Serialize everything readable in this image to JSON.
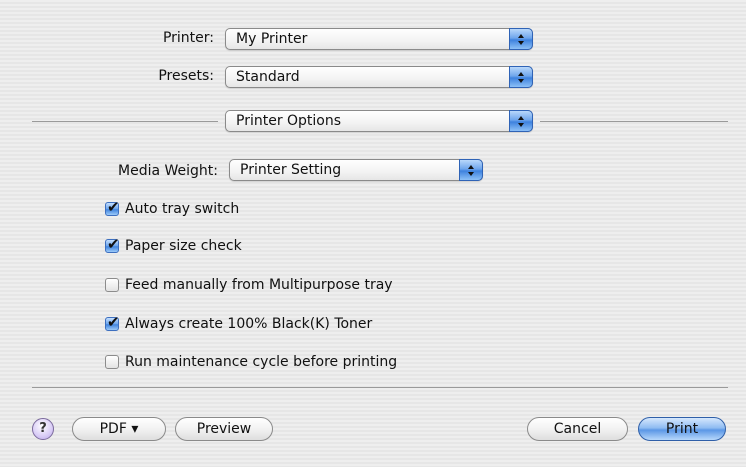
{
  "printer": {
    "label": "Printer:",
    "value": "My Printer"
  },
  "presets": {
    "label": "Presets:",
    "value": "Standard"
  },
  "panel": {
    "value": "Printer Options"
  },
  "media_weight": {
    "label": "Media Weight:",
    "value": "Printer Setting"
  },
  "options": [
    {
      "label": "Auto tray switch",
      "checked": true
    },
    {
      "label": "Paper size check",
      "checked": true
    },
    {
      "label": "Feed manually from Multipurpose tray",
      "checked": false
    },
    {
      "label": "Always create 100% Black(K) Toner",
      "checked": true
    },
    {
      "label": "Run maintenance cycle before printing",
      "checked": false
    }
  ],
  "buttons": {
    "help": "?",
    "pdf": "PDF ▾",
    "preview": "Preview",
    "cancel": "Cancel",
    "print": "Print"
  },
  "check_glyph": "✔"
}
